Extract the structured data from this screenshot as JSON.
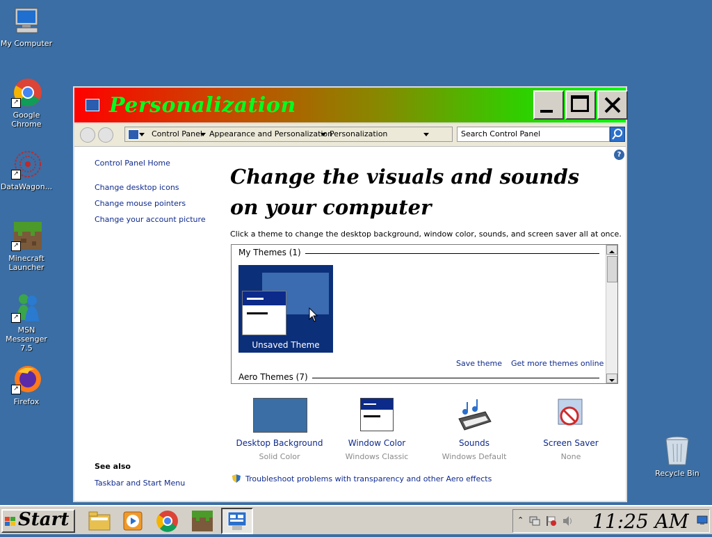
{
  "desktop": {
    "icons": [
      {
        "label": "My Computer",
        "icon": "my-computer-icon"
      },
      {
        "label": "Google Chrome",
        "icon": "chrome-icon"
      },
      {
        "label": "DataWagon...",
        "icon": "datawagon-icon"
      },
      {
        "label": "Minecraft Launcher",
        "icon": "minecraft-icon"
      },
      {
        "label": "MSN Messenger 7.5",
        "icon": "msn-messenger-icon"
      },
      {
        "label": "Firefox",
        "icon": "firefox-icon"
      },
      {
        "label": "Recycle Bin",
        "icon": "recycle-bin-icon"
      }
    ]
  },
  "window": {
    "title": "Personalization",
    "address": {
      "crumbs": [
        "Control Panel",
        "Appearance and Personalization",
        "Personalization"
      ]
    },
    "search_placeholder": "Search Control Panel",
    "sidebar": {
      "home": "Control Panel Home",
      "links": [
        "Change desktop icons",
        "Change mouse pointers",
        "Change your account picture"
      ],
      "see_also_heading": "See also",
      "see_also_links": [
        "Taskbar and Start Menu"
      ]
    },
    "heading": "Change the visuals and sounds on your computer",
    "subtext": "Click a theme to change the desktop background, window color, sounds, and screen saver all at once.",
    "themes": {
      "my_themes_label": "My Themes (1)",
      "selected_theme": "Unsaved Theme",
      "save_link": "Save theme",
      "more_link": "Get more themes online",
      "aero_label": "Aero Themes (7)"
    },
    "bottom_items": [
      {
        "name": "Desktop Background",
        "value": "Solid Color"
      },
      {
        "name": "Window Color",
        "value": "Windows Classic"
      },
      {
        "name": "Sounds",
        "value": "Windows Default"
      },
      {
        "name": "Screen Saver",
        "value": "None"
      }
    ],
    "troubleshoot": "Troubleshoot problems with transparency and other Aero effects"
  },
  "taskbar": {
    "start_label": "Start",
    "pinned": [
      "file-explorer-icon",
      "media-player-icon",
      "chrome-icon",
      "minecraft-icon",
      "control-panel-icon"
    ],
    "clock": "11:25 AM"
  },
  "colors": {
    "desktop": "#3a6ea5",
    "link": "#0f2a8c",
    "title_text": "#00ff20"
  }
}
